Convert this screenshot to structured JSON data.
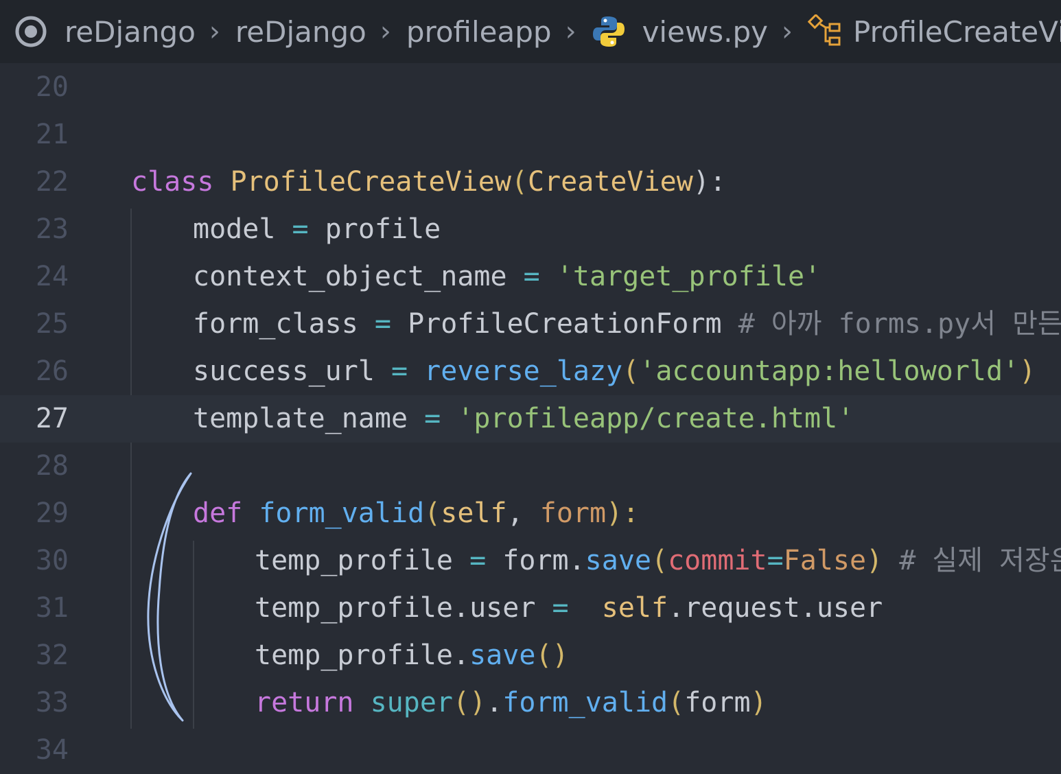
{
  "breadcrumb": {
    "items": [
      {
        "label": "reDjango",
        "icon": "workspace-circle-icon"
      },
      {
        "label": "reDjango",
        "icon": ""
      },
      {
        "label": "profileapp",
        "icon": ""
      },
      {
        "label": "views.py",
        "icon": "python-icon"
      },
      {
        "label": "ProfileCreateView",
        "icon": "class-symbol-icon"
      }
    ]
  },
  "editor": {
    "current_line": 27,
    "lines": [
      {
        "num": "20"
      },
      {
        "num": "21"
      },
      {
        "num": "22",
        "t": [
          "class",
          " ",
          "ProfileCreateView",
          "(",
          "CreateView",
          "):"
        ]
      },
      {
        "num": "23",
        "t": [
          "model",
          " = ",
          "profile"
        ]
      },
      {
        "num": "24",
        "t": [
          "context_object_name",
          " = ",
          "'target_profile'"
        ]
      },
      {
        "num": "25",
        "t": [
          "form_class",
          " = ",
          "ProfileCreationForm",
          " # 아까 forms.py서 만든거"
        ]
      },
      {
        "num": "26",
        "t": [
          "success_url",
          " = ",
          "reverse_lazy",
          "(",
          "'accountapp:helloworld'",
          ")"
        ]
      },
      {
        "num": "27",
        "t": [
          "template_name",
          " = ",
          "'profileapp/create.html'"
        ]
      },
      {
        "num": "28"
      },
      {
        "num": "29",
        "t": [
          "def",
          " ",
          "form_valid",
          "(",
          "self",
          ", ",
          "form",
          "):"
        ]
      },
      {
        "num": "30",
        "t": [
          "temp_profile",
          " = ",
          "form.",
          "save",
          "(",
          "commit",
          "=",
          "False",
          ")",
          " # 실제 저장은"
        ]
      },
      {
        "num": "31",
        "t": [
          "temp_profile.user",
          " = ",
          " ",
          "self",
          ".request.user"
        ]
      },
      {
        "num": "32",
        "t": [
          "temp_profile.",
          "save",
          "()"
        ]
      },
      {
        "num": "33",
        "t": [
          "return",
          " ",
          "super",
          "()",
          ".",
          "form_valid",
          "(",
          "form",
          ")"
        ]
      },
      {
        "num": "34"
      }
    ]
  }
}
